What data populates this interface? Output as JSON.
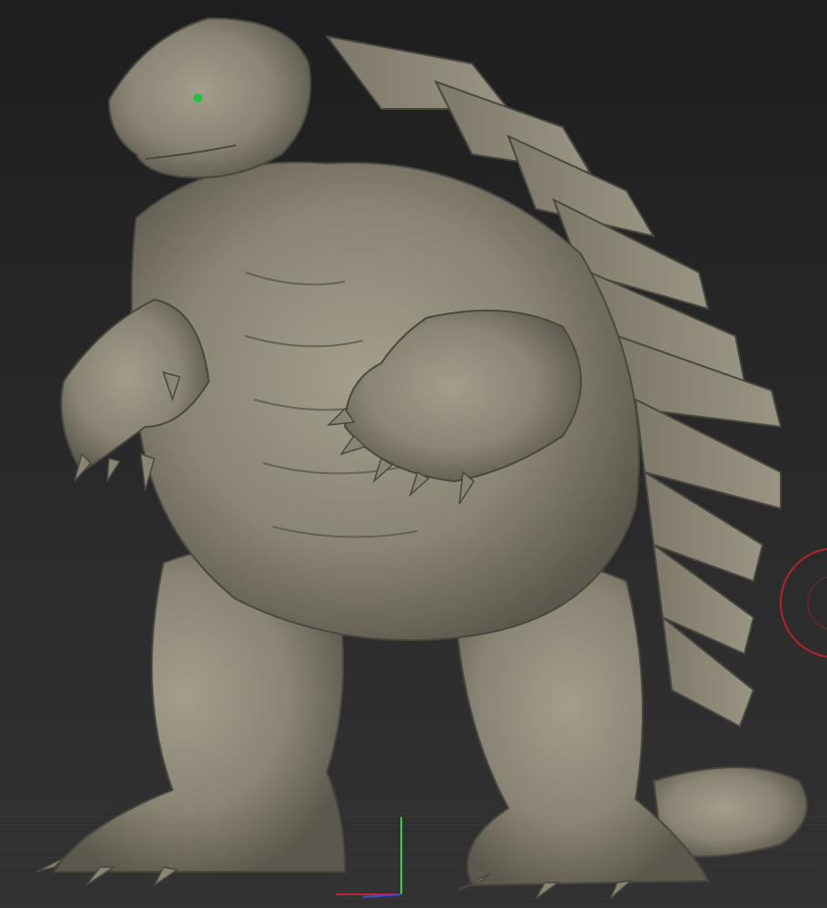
{
  "viewport": {
    "content": "3d-sculpt-model",
    "model_color": "#8a8474",
    "model_highlight": "#a39d8c",
    "model_shadow": "#5c584d",
    "eye_color": "#22c040",
    "background_top": "#1e1e1f",
    "background_bottom": "#323233"
  },
  "gizmos": {
    "axis_y_color": "#2bd24a",
    "axis_x_color": "#c0283a",
    "axis_z_color": "#3a4cd8",
    "rotate_ring_color": "#b8232b"
  }
}
